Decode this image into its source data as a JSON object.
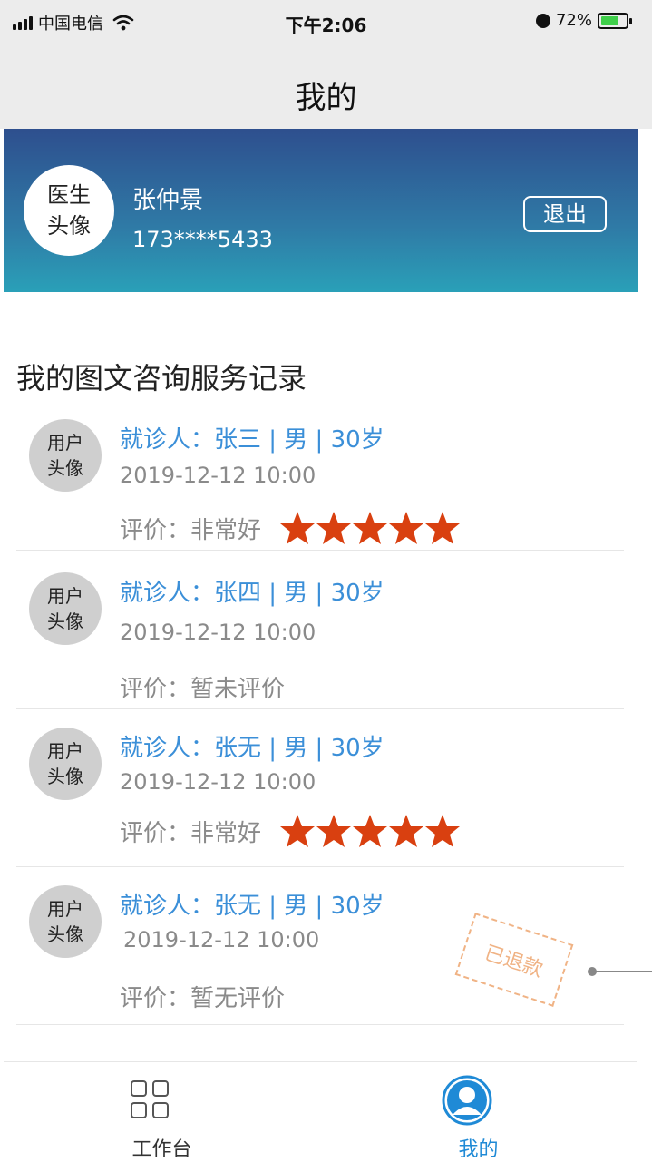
{
  "status_bar": {
    "carrier": "中国电信",
    "time": "下午2:06",
    "battery": "72%"
  },
  "nav": {
    "title": "我的"
  },
  "profile": {
    "avatar_line1": "医生",
    "avatar_line2": "头像",
    "name": "张仲景",
    "phone": "173****5433",
    "logout_label": "退出"
  },
  "section": {
    "title": "我的图文咨询服务记录"
  },
  "records": [
    {
      "avatar_line1": "用户",
      "avatar_line2": "头像",
      "patient": "就诊人：张三 | 男 | 30岁",
      "time": "2019-12-12 10:00",
      "rating_text": "评价：非常好",
      "stars": 5
    },
    {
      "avatar_line1": "用户",
      "avatar_line2": "头像",
      "patient": "就诊人：张四 | 男 | 30岁",
      "time": "2019-12-12 10:00",
      "rating_text": "评价：暂未评价",
      "stars": 0
    },
    {
      "avatar_line1": "用户",
      "avatar_line2": "头像",
      "patient": "就诊人：张无 | 男 | 30岁",
      "time": "2019-12-12 10:00",
      "rating_text": "评价：非常好",
      "stars": 5
    },
    {
      "avatar_line1": "用户",
      "avatar_line2": "头像",
      "patient": "就诊人：张无 | 男 | 30岁",
      "time": "2019-12-12 10:00",
      "rating_text": "评价：暂无评价",
      "stars": 0,
      "stamp": "已退款"
    }
  ],
  "tabs": {
    "workbench": "工作台",
    "mine": "我的"
  },
  "colors": {
    "accent": "#3b8fd8",
    "star": "#d94010",
    "banner_top": "#2e4f8e",
    "banner_bottom": "#2aa0b8",
    "stamp": "#f0b385"
  },
  "icons": {
    "workbench": "grid-icon",
    "mine": "person-icon"
  }
}
